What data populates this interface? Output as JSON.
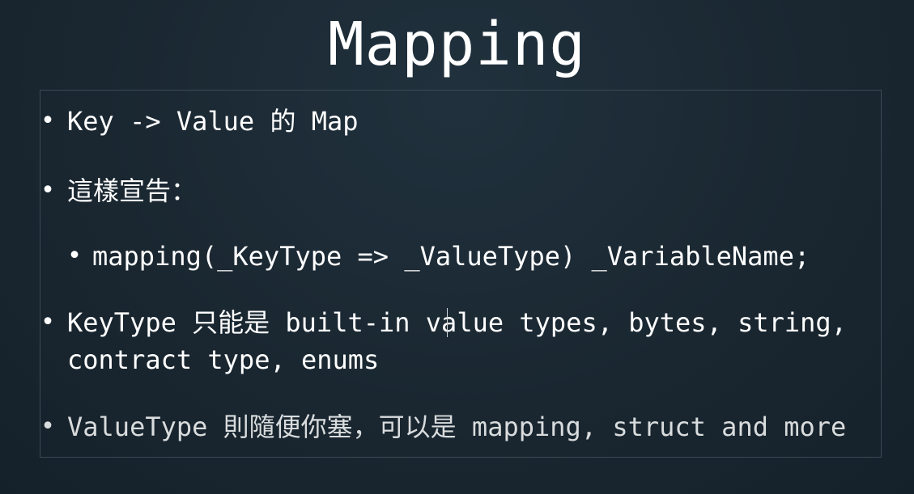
{
  "slide": {
    "title": "Mapping",
    "bullets": [
      {
        "text": "Key -> Value 的 Map",
        "level": 1
      },
      {
        "text": "這樣宣告：",
        "level": 1
      },
      {
        "text": "mapping(_KeyType => _ValueType) _VariableName;",
        "level": 2
      },
      {
        "text": "KeyType 只能是 built-in value types, bytes, string,",
        "continuation": "contract type, enums",
        "level": 1
      },
      {
        "text": "ValueType 則隨便你塞，可以是 mapping, struct and more",
        "level": 1
      }
    ],
    "bullet_symbol": "•"
  }
}
